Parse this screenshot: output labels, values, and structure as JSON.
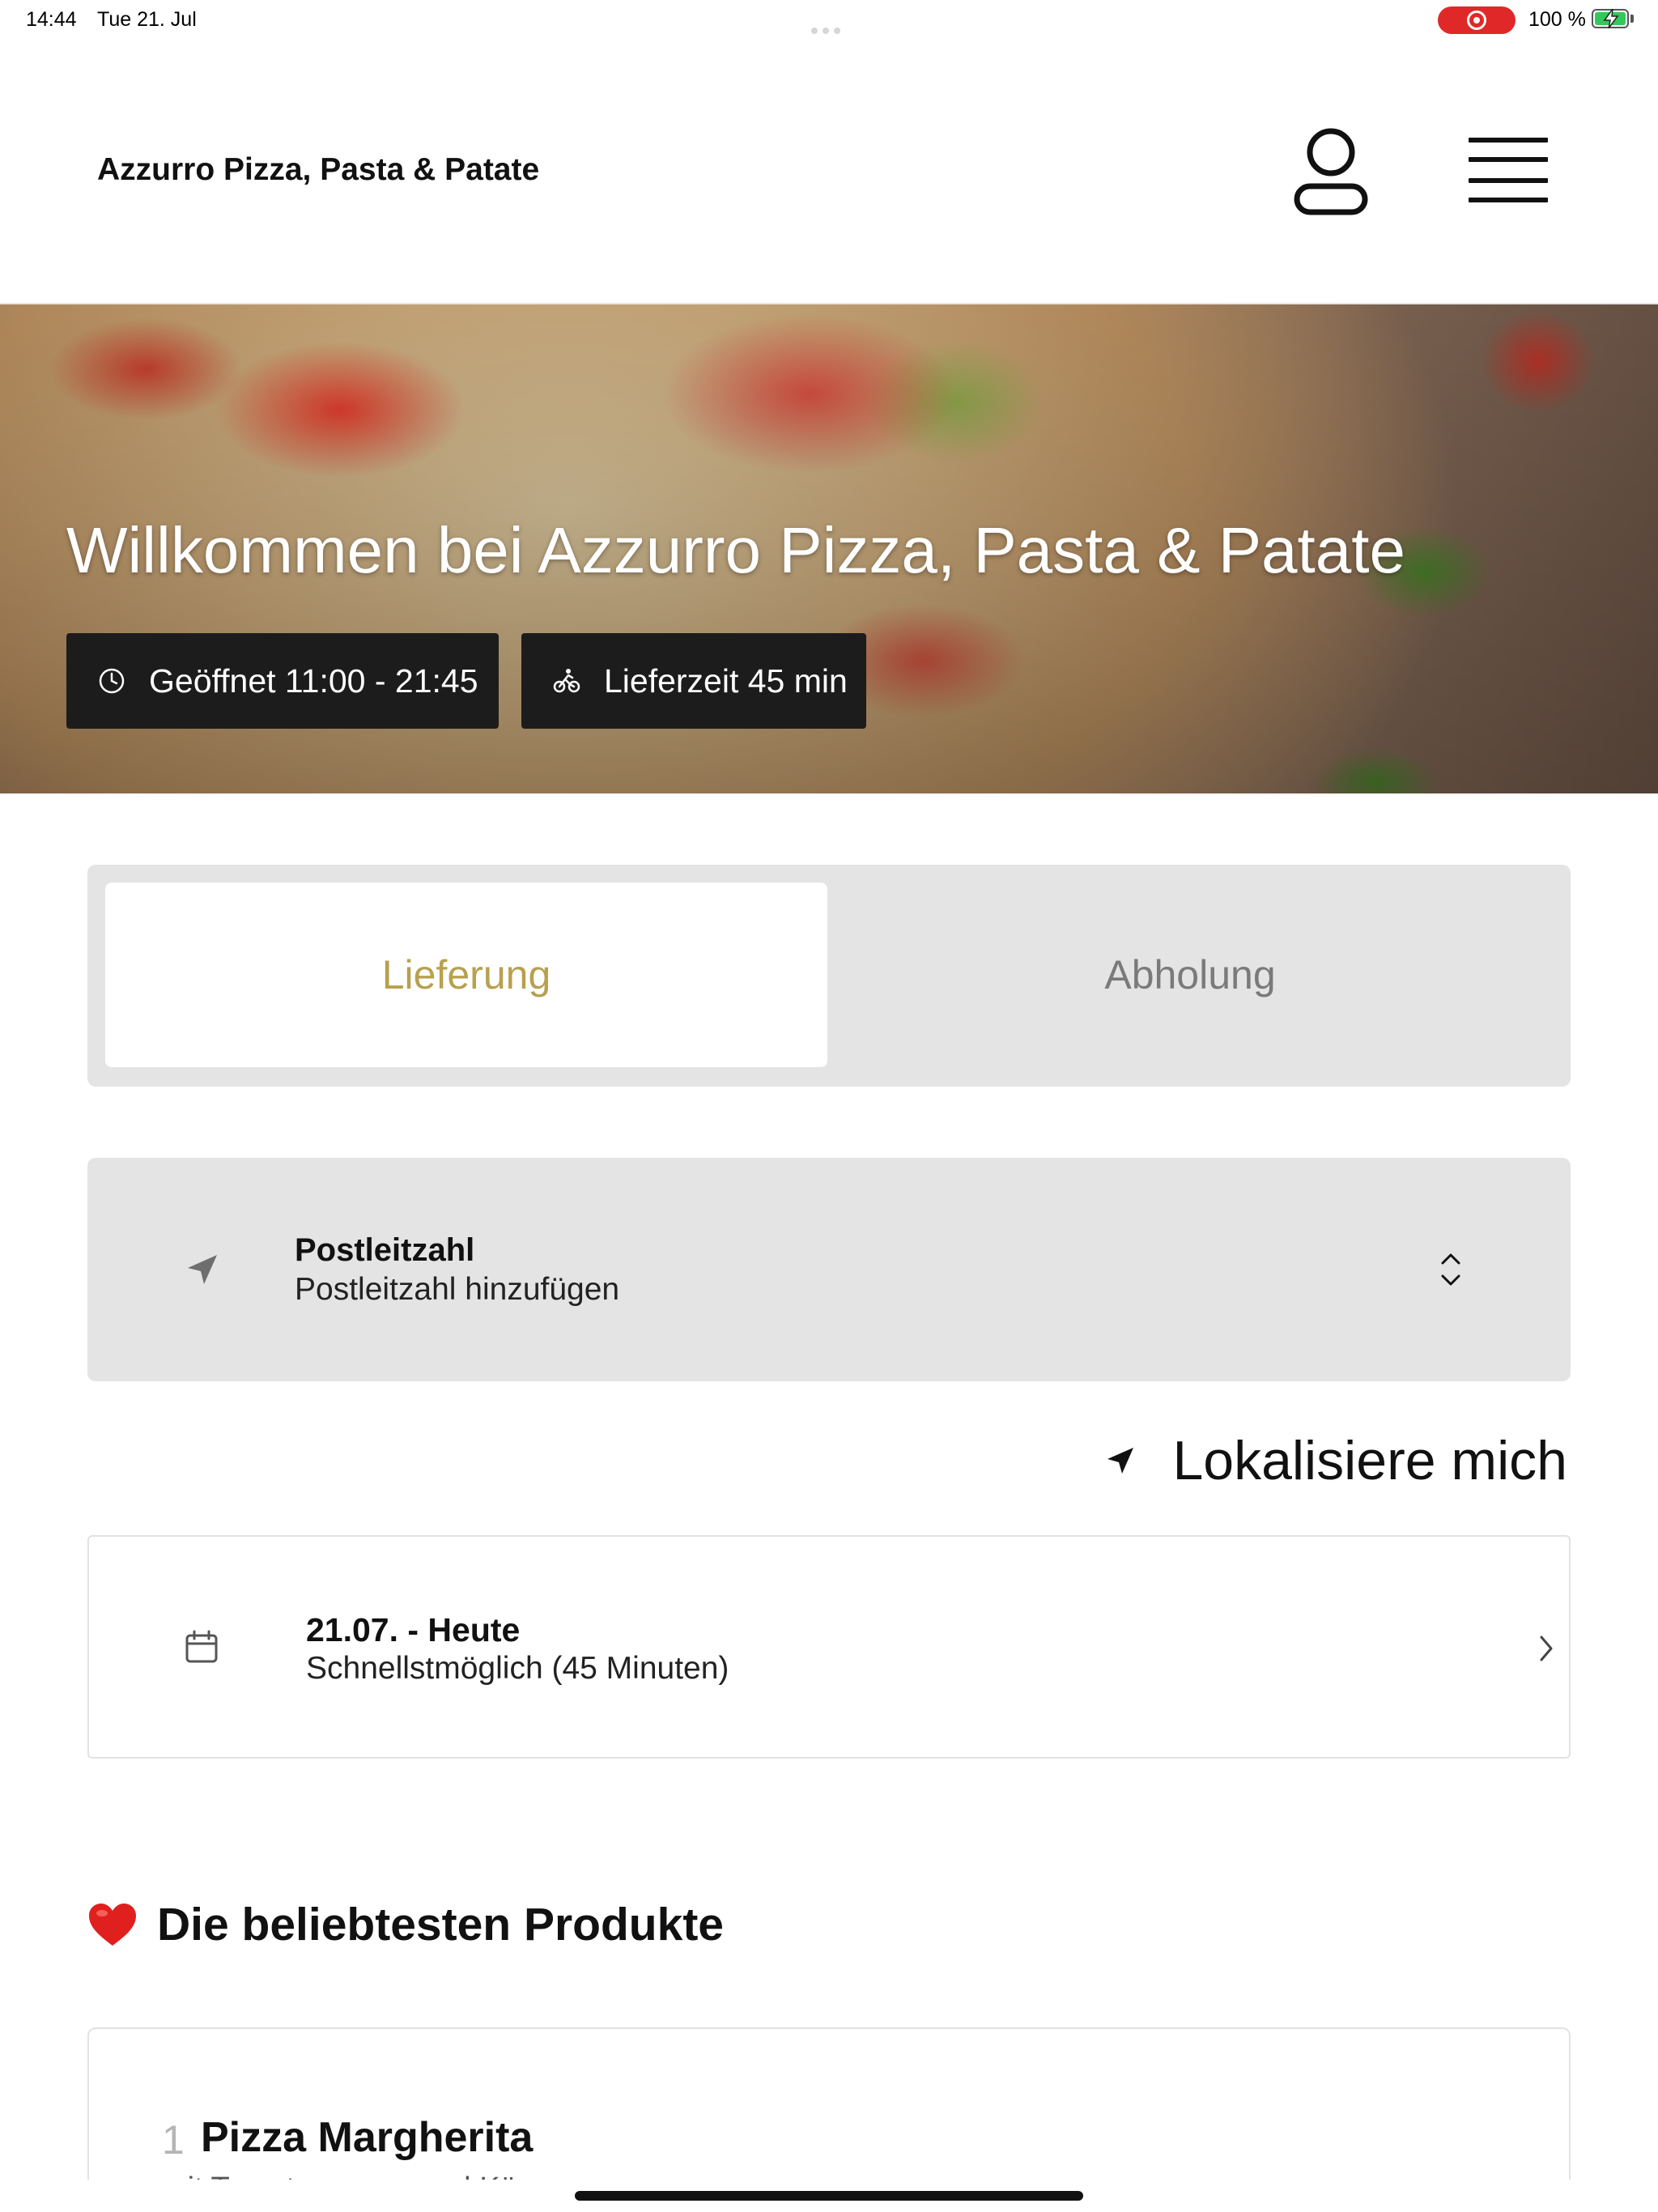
{
  "status_bar": {
    "time": "14:44",
    "date": "Tue 21. Jul",
    "battery_percent": "100 %",
    "battery_level": 1.0,
    "recording_indicator": "screen-recording",
    "colors": {
      "recording": "#e02828",
      "battery": "#34c759"
    }
  },
  "header": {
    "title": "Azzurro Pizza, Pasta & Patate",
    "user_icon": "user-icon",
    "menu_icon": "hamburger-menu-icon"
  },
  "hero": {
    "title": "Willkommen bei Azzurro Pizza, Pasta & Patate",
    "opening_hours": {
      "icon": "clock-icon",
      "label": "Geöffnet 11:00 - 21:45"
    },
    "delivery_time": {
      "icon": "bicycle-icon",
      "label": "Lieferzeit 45 min"
    }
  },
  "order_mode": {
    "options": [
      {
        "label": "Lieferung",
        "selected": true
      },
      {
        "label": "Abholung",
        "selected": false
      }
    ],
    "accent_color": "#b8a04e"
  },
  "postcode": {
    "icon": "navigation-arrow-icon",
    "label": "Postleitzahl",
    "placeholder": "Postleitzahl hinzufügen",
    "chevron_icon": "chevron-up-down-icon"
  },
  "locate_me": {
    "icon": "location-arrow-icon",
    "label": "Lokalisiere mich"
  },
  "schedule": {
    "icon": "calendar-icon",
    "label": "21.07. - Heute",
    "value": "Schnellstmöglich (45 Minuten)",
    "chevron_icon": "chevron-right-icon"
  },
  "popular": {
    "heading": "Die beliebtesten Produkte",
    "heading_icon": "heart-icon",
    "products": [
      {
        "rank": "1",
        "name": "Pizza Margherita",
        "description": "mit Tomatensauce und Käse"
      }
    ]
  }
}
